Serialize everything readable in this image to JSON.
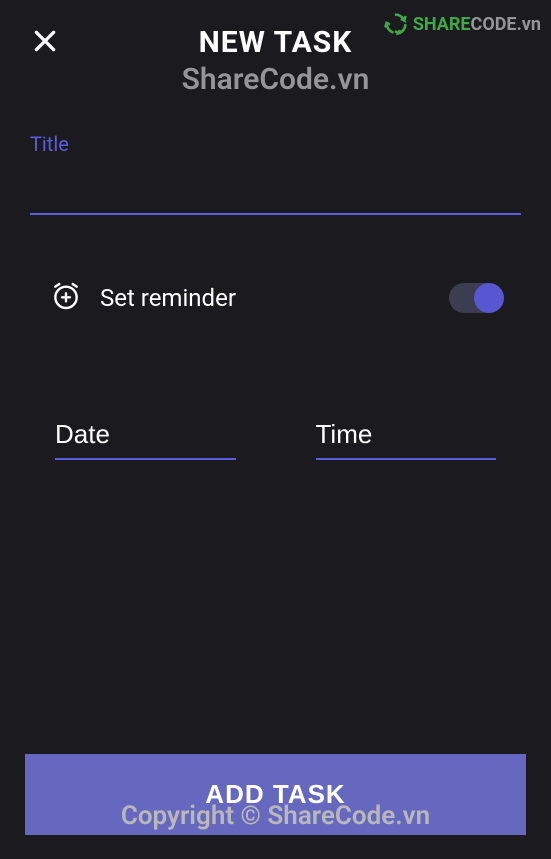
{
  "header": {
    "title": "NEW TASK"
  },
  "watermarks": {
    "subtitle": "ShareCode.vn",
    "logo_share": "SHARE",
    "logo_code": "CODE",
    "logo_suffix": ".vn",
    "copyright": "Copyright © ShareCode.vn"
  },
  "fields": {
    "title_label": "Title",
    "title_value": "",
    "reminder_label": "Set reminder",
    "reminder_on": true,
    "date_placeholder": "Date",
    "date_value": "",
    "time_placeholder": "Time",
    "time_value": ""
  },
  "buttons": {
    "add_task": "ADD TASK"
  }
}
